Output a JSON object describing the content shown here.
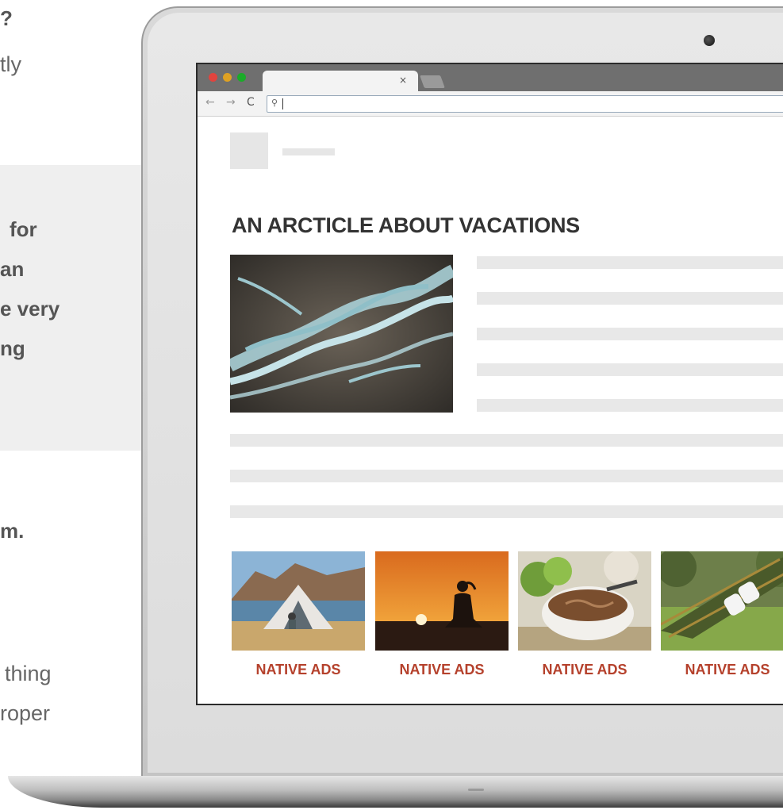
{
  "side_text": {
    "line_1": "?",
    "line_2": "tly",
    "panel_lines": [
      "for",
      "an",
      "e very",
      "ng"
    ],
    "line_m": "m.",
    "line_thing": "thing",
    "line_roper": "roper"
  },
  "browser": {
    "tab_close": "×",
    "back_icon": "←",
    "forward_icon": "→",
    "reload_icon": "C",
    "search_icon": "⚲"
  },
  "article": {
    "headline": "AN ARCTICLE ABOUT VACATIONS"
  },
  "ads": [
    {
      "label": "NATIVE ADS"
    },
    {
      "label": "NATIVE ADS"
    },
    {
      "label": "NATIVE ADS"
    },
    {
      "label": "NATIVE ADS"
    }
  ],
  "colors": {
    "ad_label": "#b5412c",
    "placeholder": "#e8e8e8",
    "headline": "#333333"
  }
}
